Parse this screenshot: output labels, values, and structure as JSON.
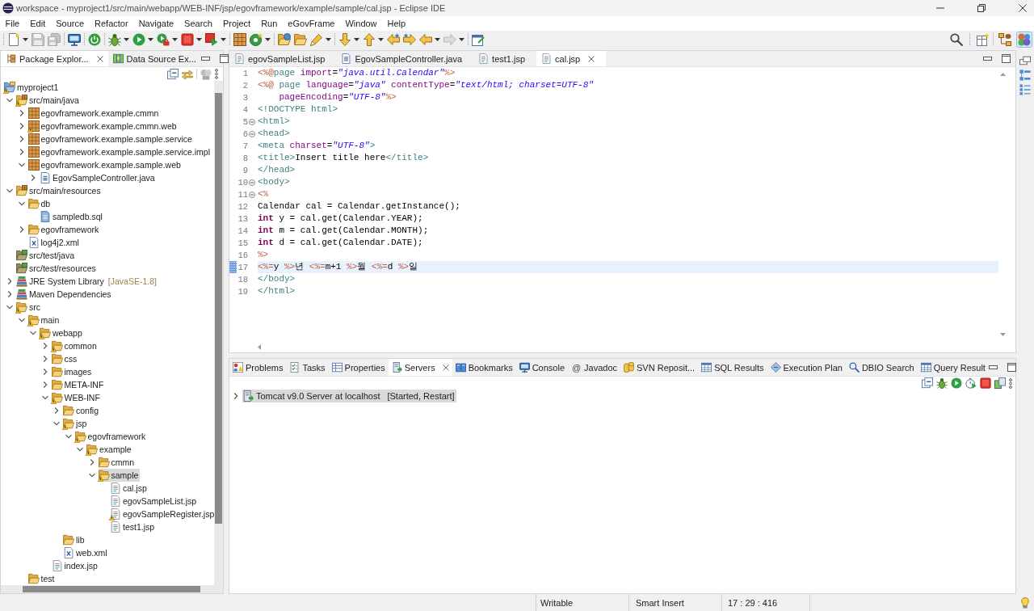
{
  "window": {
    "title": "workspace - myproject1/src/main/webapp/WEB-INF/jsp/egovframework/example/sample/cal.jsp - Eclipse IDE"
  },
  "menu": [
    "File",
    "Edit",
    "Source",
    "Refactor",
    "Navigate",
    "Search",
    "Project",
    "Run",
    "eGovFrame",
    "Window",
    "Help"
  ],
  "toolbar": {
    "groups": [
      [
        {
          "kind": "new",
          "dropdown": true,
          "disabled": false
        },
        {
          "kind": "save",
          "dropdown": false,
          "disabled": true
        },
        {
          "kind": "save-all",
          "dropdown": false,
          "disabled": true
        }
      ],
      [
        {
          "kind": "terminal",
          "dropdown": false,
          "disabled": false
        }
      ],
      [
        {
          "kind": "power",
          "dropdown": false,
          "disabled": false
        }
      ],
      [
        {
          "kind": "debug",
          "dropdown": true,
          "disabled": false
        },
        {
          "kind": "run",
          "dropdown": true,
          "disabled": false
        },
        {
          "kind": "run-tool",
          "dropdown": true,
          "disabled": false
        },
        {
          "kind": "stop",
          "dropdown": true,
          "disabled": false
        },
        {
          "kind": "stop-play",
          "dropdown": true,
          "disabled": false
        }
      ],
      [
        {
          "kind": "crate",
          "dropdown": false,
          "disabled": false
        },
        {
          "kind": "new-class",
          "dropdown": true,
          "disabled": false
        }
      ],
      [
        {
          "kind": "open-type",
          "dropdown": false,
          "disabled": false
        },
        {
          "kind": "open-folder",
          "dropdown": false,
          "disabled": false
        },
        {
          "kind": "pen",
          "dropdown": true,
          "disabled": false
        }
      ],
      [
        {
          "kind": "next",
          "dropdown": true,
          "disabled": false
        },
        {
          "kind": "previous",
          "dropdown": true,
          "disabled": false
        },
        {
          "kind": "last-edit-back",
          "dropdown": false,
          "disabled": false
        },
        {
          "kind": "last-edit-forward",
          "dropdown": false,
          "disabled": false
        },
        {
          "kind": "back",
          "dropdown": true,
          "disabled": false
        },
        {
          "kind": "forward",
          "dropdown": true,
          "disabled": true
        }
      ],
      [
        {
          "kind": "pin",
          "dropdown": false,
          "disabled": false
        }
      ]
    ],
    "perspectives": [
      {
        "kind": "java-ee",
        "selected": false
      },
      {
        "kind": "egov",
        "selected": true
      }
    ]
  },
  "explorer": {
    "tabs": [
      {
        "label": "Package Explor...",
        "kind": "package-explorer",
        "selected": true
      },
      {
        "label": "Data Source Ex...",
        "kind": "data-source",
        "selected": false
      }
    ],
    "tree": [
      {
        "label": "myproject1",
        "kind": "project",
        "warning": true,
        "selected": false,
        "children": [
          {
            "label": "src/main/java",
            "kind": "source-folder",
            "expanded": true,
            "warning": true,
            "selected": false,
            "children": [
              {
                "label": "egovframework.example.cmmn",
                "kind": "package",
                "expanded": false,
                "warning": false,
                "selected": false
              },
              {
                "label": "egovframework.example.cmmn.web",
                "kind": "package",
                "expanded": false,
                "warning": true,
                "selected": false
              },
              {
                "label": "egovframework.example.sample.service",
                "kind": "package",
                "expanded": false,
                "warning": false,
                "selected": false
              },
              {
                "label": "egovframework.example.sample.service.impl",
                "kind": "package",
                "expanded": false,
                "warning": false,
                "selected": false
              },
              {
                "label": "egovframework.example.sample.web",
                "kind": "package",
                "expanded": true,
                "warning": false,
                "selected": false,
                "children": [
                  {
                    "label": "EgovSampleController.java",
                    "kind": "java-file",
                    "expanded": false,
                    "warning": false,
                    "selected": false
                  }
                ]
              }
            ]
          },
          {
            "label": "src/main/resources",
            "kind": "source-folder",
            "expanded": true,
            "warning": false,
            "selected": false,
            "children": [
              {
                "label": "db",
                "kind": "folder",
                "expanded": true,
                "warning": false,
                "selected": false,
                "children": [
                  {
                    "label": "sampledb.sql",
                    "kind": "sql-file",
                    "warning": false,
                    "selected": false
                  }
                ]
              },
              {
                "label": "egovframework",
                "kind": "folder",
                "expanded": false,
                "warning": false,
                "selected": false
              },
              {
                "label": "log4j2.xml",
                "kind": "xml-file",
                "warning": false,
                "selected": false
              }
            ]
          },
          {
            "label": "src/test/java",
            "kind": "test-folder",
            "warning": false,
            "selected": false
          },
          {
            "label": "src/test/resources",
            "kind": "test-folder",
            "warning": false,
            "selected": false
          },
          {
            "label": "JRE System Library",
            "qualifier": "[JavaSE-1.8]",
            "kind": "library",
            "expanded": false,
            "warning": false,
            "selected": false
          },
          {
            "label": "Maven Dependencies",
            "kind": "library",
            "expanded": false,
            "warning": false,
            "selected": false
          },
          {
            "label": "src",
            "kind": "folder",
            "expanded": true,
            "warning": true,
            "selected": false,
            "children": [
              {
                "label": "main",
                "kind": "folder",
                "expanded": true,
                "warning": true,
                "selected": false,
                "children": [
                  {
                    "label": "webapp",
                    "kind": "folder",
                    "expanded": true,
                    "warning": true,
                    "selected": false,
                    "children": [
                      {
                        "label": "common",
                        "kind": "folder",
                        "expanded": false,
                        "warning": true,
                        "selected": false
                      },
                      {
                        "label": "css",
                        "kind": "folder",
                        "expanded": false,
                        "warning": false,
                        "selected": false
                      },
                      {
                        "label": "images",
                        "kind": "folder",
                        "expanded": false,
                        "warning": false,
                        "selected": false
                      },
                      {
                        "label": "META-INF",
                        "kind": "folder",
                        "expanded": false,
                        "warning": false,
                        "selected": false
                      },
                      {
                        "label": "WEB-INF",
                        "kind": "folder",
                        "expanded": true,
                        "warning": true,
                        "selected": false,
                        "children": [
                          {
                            "label": "config",
                            "kind": "folder",
                            "expanded": false,
                            "warning": false,
                            "selected": false
                          },
                          {
                            "label": "jsp",
                            "kind": "folder",
                            "expanded": true,
                            "warning": true,
                            "selected": false,
                            "children": [
                              {
                                "label": "egovframework",
                                "kind": "folder",
                                "expanded": true,
                                "warning": true,
                                "selected": false,
                                "children": [
                                  {
                                    "label": "example",
                                    "kind": "folder",
                                    "expanded": true,
                                    "warning": true,
                                    "selected": false,
                                    "children": [
                                      {
                                        "label": "cmmn",
                                        "kind": "folder",
                                        "expanded": false,
                                        "warning": false,
                                        "selected": false
                                      },
                                      {
                                        "label": "sample",
                                        "kind": "folder",
                                        "expanded": true,
                                        "warning": true,
                                        "selected": true,
                                        "children": [
                                          {
                                            "label": "cal.jsp",
                                            "kind": "jsp-file",
                                            "warning": false,
                                            "selected": false
                                          },
                                          {
                                            "label": "egovSampleList.jsp",
                                            "kind": "jsp-file",
                                            "warning": false,
                                            "selected": false
                                          },
                                          {
                                            "label": "egovSampleRegister.jsp",
                                            "kind": "jsp-file",
                                            "warning": true,
                                            "selected": false
                                          },
                                          {
                                            "label": "test1.jsp",
                                            "kind": "jsp-file",
                                            "warning": false,
                                            "selected": false
                                          }
                                        ]
                                      }
                                    ]
                                  }
                                ]
                              }
                            ]
                          },
                          {
                            "label": "lib",
                            "kind": "folder",
                            "warning": false,
                            "selected": false
                          },
                          {
                            "label": "web.xml",
                            "kind": "xml-file",
                            "warning": false,
                            "selected": false
                          }
                        ]
                      },
                      {
                        "label": "index.jsp",
                        "kind": "jsp-file",
                        "warning": false,
                        "selected": false
                      }
                    ]
                  }
                ]
              },
              {
                "label": "test",
                "kind": "folder",
                "warning": false,
                "selected": false
              }
            ]
          }
        ]
      }
    ]
  },
  "editor": {
    "tabs": [
      {
        "label": "egovSampleList.jsp",
        "kind": "jsp-file",
        "selected": false
      },
      {
        "label": "EgovSampleController.java",
        "kind": "java-file",
        "selected": false
      },
      {
        "label": "test1.jsp",
        "kind": "jsp-file",
        "selected": false
      },
      {
        "label": "cal.jsp",
        "kind": "jsp-file",
        "selected": true
      }
    ],
    "lines": [
      {
        "number": "1",
        "foldable": false,
        "current": false,
        "marker": false,
        "tokens": [
          {
            "kind": "jsp",
            "text": "<%@"
          },
          {
            "kind": "tag",
            "text": "page"
          },
          {
            "kind": "attr",
            "text": " import"
          },
          {
            "kind": "plain",
            "text": "="
          },
          {
            "kind": "string",
            "text": "\"java.util.Calendar\""
          },
          {
            "kind": "jsp",
            "text": "%>"
          }
        ]
      },
      {
        "number": "2",
        "foldable": false,
        "current": false,
        "marker": false,
        "tokens": [
          {
            "kind": "jsp",
            "text": "<%@"
          },
          {
            "kind": "tag",
            "text": " page"
          },
          {
            "kind": "attr",
            "text": " language"
          },
          {
            "kind": "plain",
            "text": "="
          },
          {
            "kind": "string",
            "text": "\"java\""
          },
          {
            "kind": "attr",
            "text": " contentType"
          },
          {
            "kind": "plain",
            "text": "="
          },
          {
            "kind": "string",
            "text": "\"text/html; charset=UTF-8\""
          }
        ]
      },
      {
        "number": "3",
        "foldable": false,
        "current": false,
        "marker": false,
        "tokens": [
          {
            "kind": "attr",
            "text": "    pageEncoding"
          },
          {
            "kind": "plain",
            "text": "="
          },
          {
            "kind": "string",
            "text": "\"UTF-8\""
          },
          {
            "kind": "jsp",
            "text": "%>"
          }
        ]
      },
      {
        "number": "4",
        "foldable": false,
        "current": false,
        "marker": false,
        "tokens": [
          {
            "kind": "tag",
            "text": "<!DOCTYPE html>"
          }
        ]
      },
      {
        "number": "5",
        "foldable": true,
        "current": false,
        "marker": false,
        "tokens": [
          {
            "kind": "tag",
            "text": "<html>"
          }
        ]
      },
      {
        "number": "6",
        "foldable": true,
        "current": false,
        "marker": false,
        "tokens": [
          {
            "kind": "tag",
            "text": "<head>"
          }
        ]
      },
      {
        "number": "7",
        "foldable": false,
        "current": false,
        "marker": false,
        "tokens": [
          {
            "kind": "tag",
            "text": "<meta"
          },
          {
            "kind": "attr",
            "text": " charset"
          },
          {
            "kind": "plain",
            "text": "="
          },
          {
            "kind": "string",
            "text": "\"UTF-8\""
          },
          {
            "kind": "tag",
            "text": ">"
          }
        ]
      },
      {
        "number": "8",
        "foldable": false,
        "current": false,
        "marker": false,
        "tokens": [
          {
            "kind": "tag",
            "text": "<title>"
          },
          {
            "kind": "plain",
            "text": "Insert title here"
          },
          {
            "kind": "tag",
            "text": "</title>"
          }
        ]
      },
      {
        "number": "9",
        "foldable": false,
        "current": false,
        "marker": false,
        "tokens": [
          {
            "kind": "tag",
            "text": "</head>"
          }
        ]
      },
      {
        "number": "10",
        "foldable": true,
        "current": false,
        "marker": false,
        "tokens": [
          {
            "kind": "tag",
            "text": "<body>"
          }
        ]
      },
      {
        "number": "11",
        "foldable": true,
        "current": false,
        "marker": false,
        "tokens": [
          {
            "kind": "jsp",
            "text": "<%"
          }
        ]
      },
      {
        "number": "12",
        "foldable": false,
        "current": false,
        "marker": false,
        "tokens": [
          {
            "kind": "plain",
            "text": "Calendar cal = Calendar.getInstance();"
          }
        ]
      },
      {
        "number": "13",
        "foldable": false,
        "current": false,
        "marker": false,
        "tokens": [
          {
            "kind": "keyword",
            "text": "int"
          },
          {
            "kind": "plain",
            "text": " y = cal.get(Calendar.YEAR);"
          }
        ]
      },
      {
        "number": "14",
        "foldable": false,
        "current": false,
        "marker": false,
        "tokens": [
          {
            "kind": "keyword",
            "text": "int"
          },
          {
            "kind": "plain",
            "text": " m = cal.get(Calendar.MONTH);"
          }
        ]
      },
      {
        "number": "15",
        "foldable": false,
        "current": false,
        "marker": false,
        "tokens": [
          {
            "kind": "keyword",
            "text": "int"
          },
          {
            "kind": "plain",
            "text": " d = cal.get(Calendar.DATE);"
          }
        ]
      },
      {
        "number": "16",
        "foldable": false,
        "current": false,
        "marker": false,
        "tokens": [
          {
            "kind": "jsp",
            "text": "%>"
          }
        ]
      },
      {
        "number": "17",
        "foldable": false,
        "current": true,
        "marker": true,
        "tokens": [
          {
            "kind": "jsp",
            "text": "<%="
          },
          {
            "kind": "plain",
            "text": "y "
          },
          {
            "kind": "jsp",
            "text": "%>"
          },
          {
            "kind": "plain",
            "text": "년 "
          },
          {
            "kind": "jsp",
            "text": "<%="
          },
          {
            "kind": "plain",
            "text": "m+1 "
          },
          {
            "kind": "jsp",
            "text": "%>"
          },
          {
            "kind": "plain",
            "text": "월 "
          },
          {
            "kind": "jsp",
            "text": "<%="
          },
          {
            "kind": "plain",
            "text": "d "
          },
          {
            "kind": "jsp",
            "text": "%>"
          },
          {
            "kind": "plain",
            "text": "일"
          }
        ]
      },
      {
        "number": "18",
        "foldable": false,
        "current": false,
        "marker": false,
        "tokens": [
          {
            "kind": "tag",
            "text": "</body>"
          }
        ]
      },
      {
        "number": "19",
        "foldable": false,
        "current": false,
        "marker": false,
        "tokens": [
          {
            "kind": "tag",
            "text": "</html>"
          }
        ]
      }
    ]
  },
  "bottom_panel": {
    "tabs": [
      {
        "label": "Problems",
        "kind": "problems",
        "selected": false
      },
      {
        "label": "Tasks",
        "kind": "tasks",
        "selected": false
      },
      {
        "label": "Properties",
        "kind": "properties",
        "selected": false
      },
      {
        "label": "Servers",
        "kind": "servers",
        "selected": true
      },
      {
        "label": "Bookmarks",
        "kind": "bookmarks",
        "selected": false
      },
      {
        "label": "Console",
        "kind": "console",
        "selected": false
      },
      {
        "label": "Javadoc",
        "kind": "javadoc",
        "glyph": "@",
        "selected": false
      },
      {
        "label": "SVN Reposit...",
        "kind": "svn",
        "selected": false
      },
      {
        "label": "SQL Results",
        "kind": "sql-results",
        "selected": false
      },
      {
        "label": "Execution Plan",
        "kind": "execution-plan",
        "selected": false
      },
      {
        "label": "DBIO Search",
        "kind": "dbio-search",
        "selected": false
      },
      {
        "label": "Query Result",
        "kind": "query-result",
        "selected": false
      }
    ],
    "servers": [
      {
        "label": "Tomcat v9.0 Server at localhost",
        "state": "[Started, Restart]",
        "expanded": false,
        "selected": true
      }
    ]
  },
  "status_bar": {
    "fields": [
      "Writable",
      "Smart Insert",
      "17 : 29 : 416"
    ]
  }
}
